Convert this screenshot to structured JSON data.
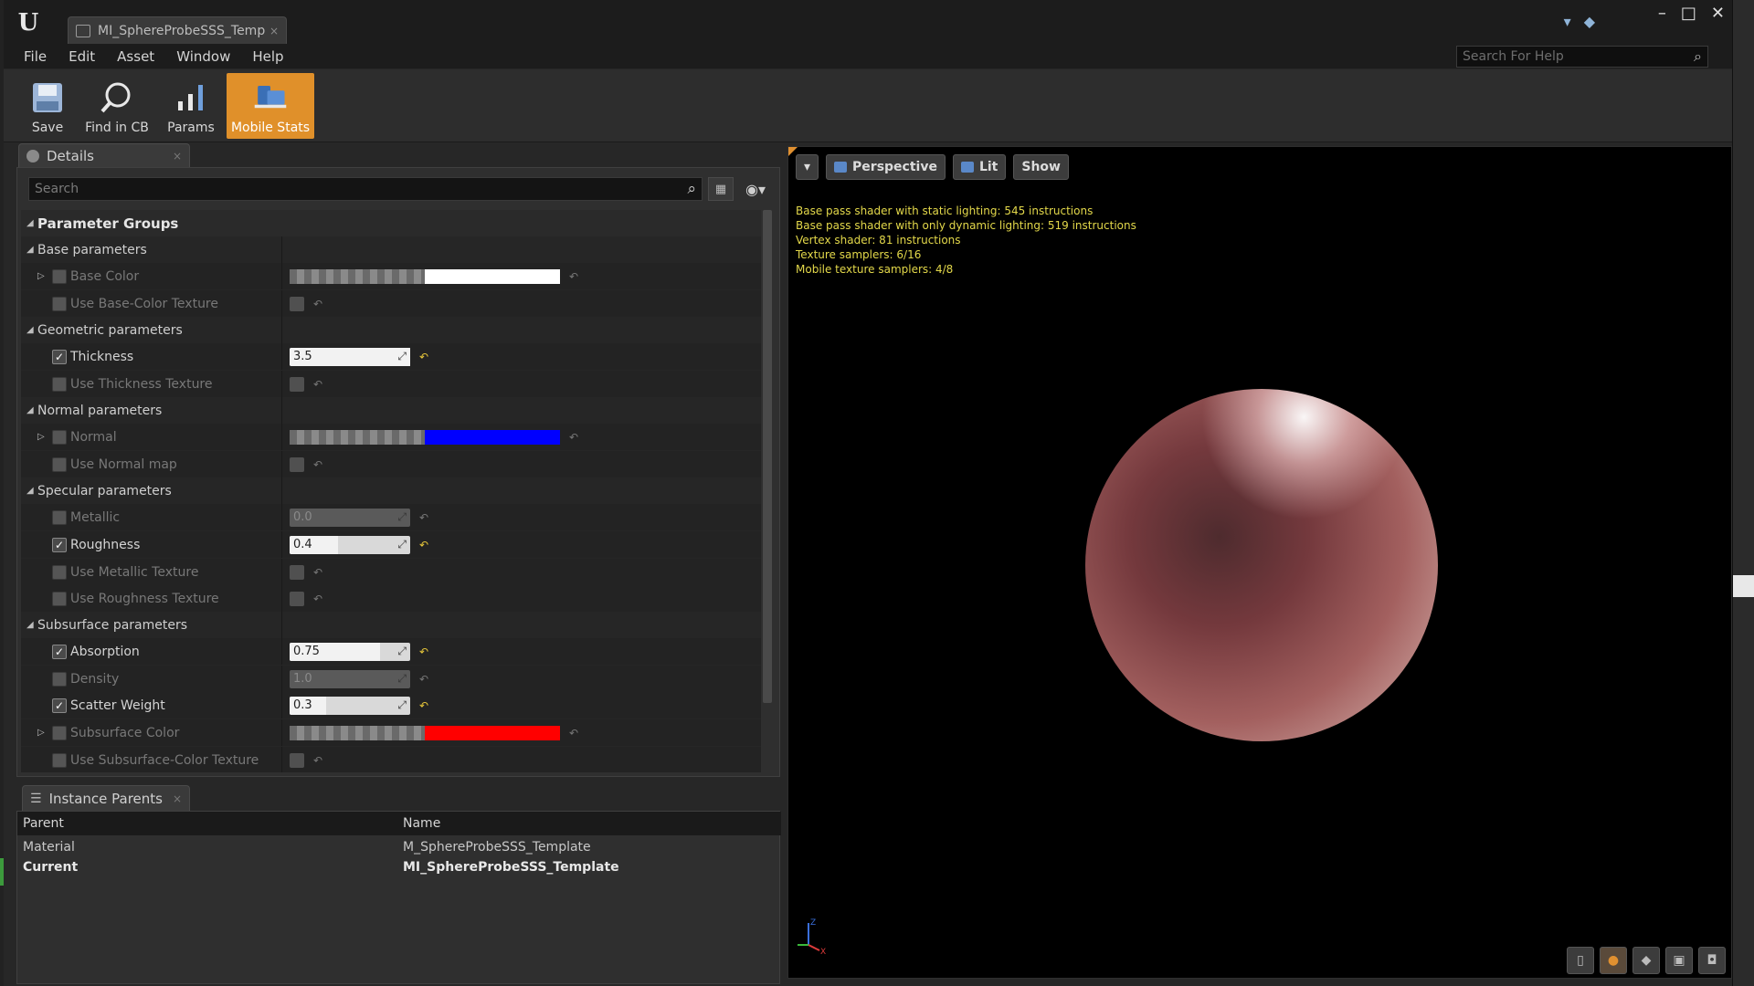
{
  "app": {
    "document_tab": "MI_SphereProbeSSS_Temp",
    "doc_tab_close": "×"
  },
  "menu": [
    "File",
    "Edit",
    "Asset",
    "Window",
    "Help"
  ],
  "help_search": {
    "placeholder": "Search For Help"
  },
  "toolbar": {
    "save": "Save",
    "find_in_cb": "Find in CB",
    "params": "Params",
    "mobile_stats": "Mobile Stats"
  },
  "details": {
    "tab_label": "Details",
    "search_placeholder": "Search",
    "root_group": "Parameter Groups",
    "groups": [
      {
        "label": "Base parameters"
      },
      {
        "label": "Geometric parameters"
      },
      {
        "label": "Normal parameters"
      },
      {
        "label": "Specular parameters"
      },
      {
        "label": "Subsurface parameters"
      }
    ],
    "props": {
      "base_color": {
        "label": "Base Color",
        "color": "#ffffff"
      },
      "use_base_color_texture": {
        "label": "Use Base-Color Texture"
      },
      "thickness": {
        "label": "Thickness",
        "value": "3.5",
        "fill": 1.0
      },
      "use_thickness_texture": {
        "label": "Use Thickness Texture"
      },
      "normal": {
        "label": "Normal",
        "color": "#0000ff"
      },
      "use_normal_map": {
        "label": "Use Normal map"
      },
      "metallic": {
        "label": "Metallic",
        "value": "0.0"
      },
      "roughness": {
        "label": "Roughness",
        "value": "0.4",
        "fill": 0.4
      },
      "use_metallic_texture": {
        "label": "Use Metallic Texture"
      },
      "use_roughness_texture": {
        "label": "Use Roughness Texture"
      },
      "absorption": {
        "label": "Absorption",
        "value": "0.75",
        "fill": 0.75
      },
      "density": {
        "label": "Density",
        "value": "1.0"
      },
      "scatter_weight": {
        "label": "Scatter Weight",
        "value": "0.3",
        "fill": 0.3
      },
      "subsurface_color": {
        "label": "Subsurface Color",
        "color": "#ff0000"
      },
      "use_subsurface_color_texture": {
        "label": "Use Subsurface-Color Texture"
      }
    }
  },
  "instance_parents": {
    "tab_label": "Instance Parents",
    "col_parent": "Parent",
    "col_name": "Name",
    "rows": [
      {
        "parent": "Material",
        "name": "M_SphereProbeSSS_Template"
      },
      {
        "parent": "Current",
        "name": "MI_SphereProbeSSS_Template"
      }
    ]
  },
  "viewport": {
    "perspective": "Perspective",
    "lit": "Lit",
    "show": "Show",
    "stats": [
      "Base pass shader with static lighting: 545 instructions",
      "Base pass shader with only dynamic lighting: 519 instructions",
      "Vertex shader: 81 instructions",
      "Texture samplers: 6/16",
      "Mobile texture samplers: 4/8"
    ],
    "axis": {
      "z": "Z",
      "x": "X",
      "y": "Y"
    }
  },
  "colors": {
    "accent": "#e0902a",
    "stats_text": "#e3d84a"
  }
}
